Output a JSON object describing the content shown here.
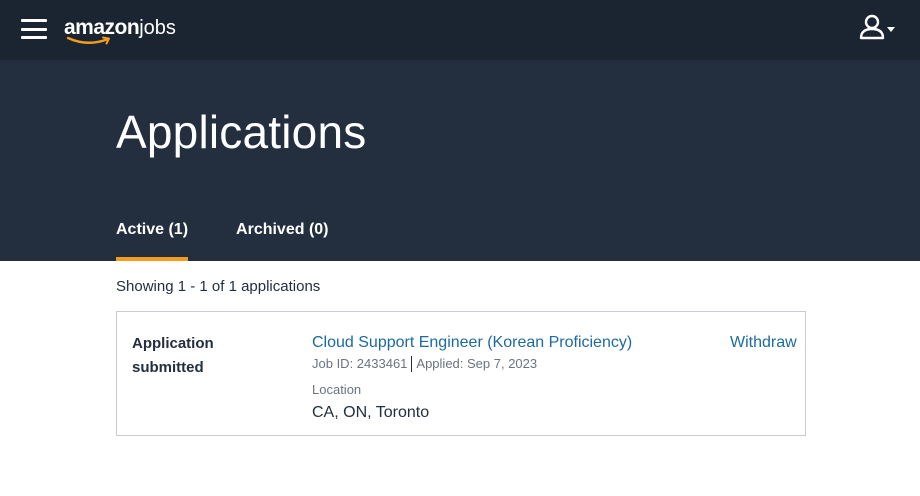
{
  "header": {
    "menu_icon": "hamburger-menu-icon",
    "logo_brand": "amazon",
    "logo_suffix": "jobs",
    "user_icon": "user-account-icon"
  },
  "hero": {
    "title": "Applications",
    "tabs": [
      {
        "label": "Active (1)",
        "active": true
      },
      {
        "label": "Archived (0)",
        "active": false
      }
    ]
  },
  "results": {
    "showing": "Showing 1 - 1 of 1 applications"
  },
  "applications": [
    {
      "status": "Application submitted",
      "job_title": "Cloud Support Engineer (Korean Proficiency)",
      "job_id": "Job ID: 2433461",
      "applied": "Applied: Sep 7, 2023",
      "location_label": "Location",
      "location": "CA, ON, Toronto",
      "action": "Withdraw"
    }
  ],
  "colors": {
    "topbar": "#1b2431",
    "hero": "#232f3e",
    "accent": "#f39c21",
    "link": "#1d6aa0"
  }
}
